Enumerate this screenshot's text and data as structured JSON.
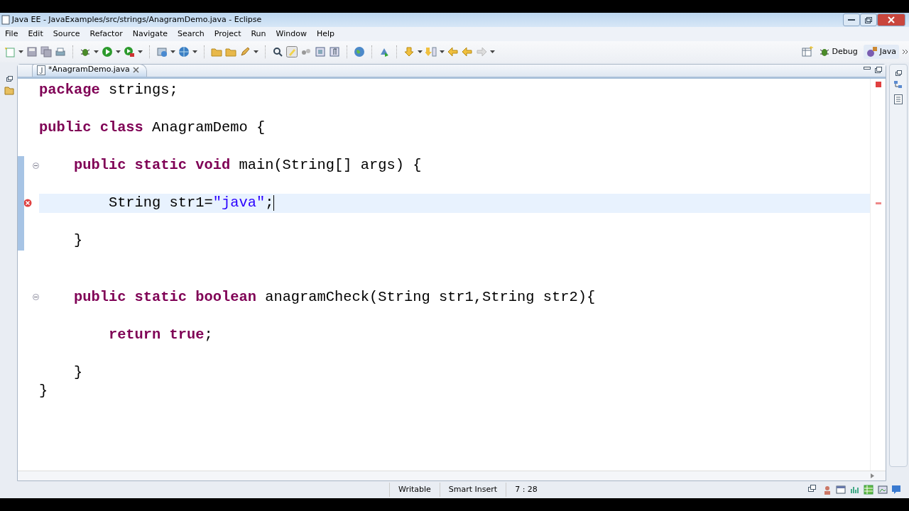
{
  "window": {
    "title": "Java EE - JavaExamples/src/strings/AnagramDemo.java - Eclipse"
  },
  "menu": [
    "File",
    "Edit",
    "Source",
    "Refactor",
    "Navigate",
    "Search",
    "Project",
    "Run",
    "Window",
    "Help"
  ],
  "perspectives": [
    {
      "label": "Debug",
      "selected": false
    },
    {
      "label": "Java",
      "selected": true
    }
  ],
  "editor_tabs": [
    {
      "label": "*AnagramDemo.java",
      "selected": true
    }
  ],
  "lines": [
    {
      "kind": "code",
      "fold": false,
      "error": false,
      "current": false,
      "range": false,
      "tokens": [
        {
          "kind": "keyword",
          "text": "package"
        },
        {
          "kind": "plain",
          "text": " strings;"
        }
      ]
    },
    {
      "kind": "blank"
    },
    {
      "kind": "code",
      "fold": false,
      "error": false,
      "current": false,
      "range": false,
      "tokens": [
        {
          "kind": "keyword",
          "text": "public class"
        },
        {
          "kind": "plain",
          "text": " AnagramDemo {"
        }
      ]
    },
    {
      "kind": "blank"
    },
    {
      "kind": "code",
      "fold": true,
      "error": false,
      "current": false,
      "range": true,
      "tokens": [
        {
          "kind": "keyword",
          "text": "    public static void"
        },
        {
          "kind": "plain",
          "text": " main(String[] args) {"
        }
      ]
    },
    {
      "kind": "blank",
      "range": true
    },
    {
      "kind": "code",
      "fold": false,
      "error": true,
      "current": true,
      "range": true,
      "tokens": [
        {
          "kind": "plain",
          "text": "        String str1="
        },
        {
          "kind": "string",
          "text": "\"java\""
        },
        {
          "kind": "plain",
          "text": ";"
        }
      ]
    },
    {
      "kind": "blank",
      "range": true
    },
    {
      "kind": "code",
      "fold": false,
      "error": false,
      "current": false,
      "range": true,
      "tokens": [
        {
          "kind": "plain",
          "text": "    }"
        }
      ]
    },
    {
      "kind": "blank"
    },
    {
      "kind": "blank"
    },
    {
      "kind": "code",
      "fold": true,
      "error": false,
      "current": false,
      "range": false,
      "tokens": [
        {
          "kind": "keyword",
          "text": "    public static boolean"
        },
        {
          "kind": "plain",
          "text": " anagramCheck(String str1,String str2){"
        }
      ]
    },
    {
      "kind": "blank"
    },
    {
      "kind": "code",
      "fold": false,
      "error": false,
      "current": false,
      "range": false,
      "tokens": [
        {
          "kind": "keyword",
          "text": "        return true"
        },
        {
          "kind": "plain",
          "text": ";"
        }
      ]
    },
    {
      "kind": "blank"
    },
    {
      "kind": "code",
      "fold": false,
      "error": false,
      "current": false,
      "range": false,
      "tokens": [
        {
          "kind": "plain",
          "text": "    }"
        }
      ]
    },
    {
      "kind": "code",
      "fold": false,
      "error": false,
      "current": false,
      "range": false,
      "tokens": [
        {
          "kind": "plain",
          "text": "}"
        }
      ]
    }
  ],
  "status_bar": [
    "Writable",
    "Smart Insert",
    "7 : 28"
  ]
}
